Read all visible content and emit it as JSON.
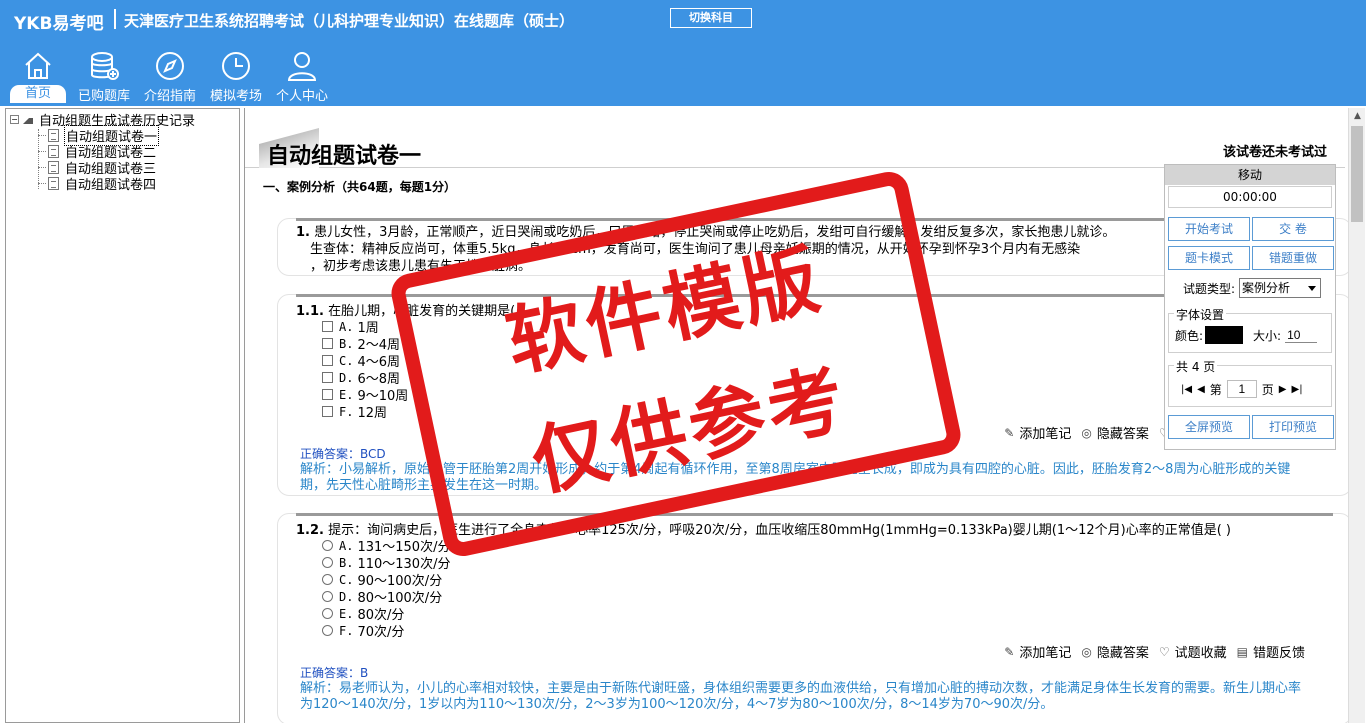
{
  "header": {
    "logo": "YKB易考吧",
    "title": "天津医疗卫生系统招聘考试（儿科护理专业知识）在线题库（硕士）",
    "switch_label": "切换科目",
    "background": "#3d93e3"
  },
  "nav": {
    "home": {
      "label": "首页",
      "icon": "home-icon"
    },
    "purchased": {
      "label": "已购题库",
      "icon": "database-icon"
    },
    "guide": {
      "label": "介绍指南",
      "icon": "compass-icon"
    },
    "mock": {
      "label": "模拟考场",
      "icon": "clock-icon"
    },
    "profile": {
      "label": "个人中心",
      "icon": "user-icon"
    }
  },
  "tree": {
    "root": "自动组题生成试卷历史记录",
    "items": [
      "自动组题试卷一",
      "自动组题试卷二",
      "自动组题试卷三",
      "自动组题试卷四"
    ]
  },
  "paper": {
    "title": "自动组题试卷一",
    "status": "该试卷还未考试过",
    "section": "一、案例分析（共64题，每题1分）"
  },
  "intro": {
    "number": "1.",
    "lines": [
      "患儿女性，3月龄，正常顺产，近日哭闹或吃奶后，口周发绀，停止哭闹或停止吃奶后，发绀可自行缓解，发绀反复多次，家长抱患儿就诊。",
      "生查体：精神反应尚可，体重5.5kg，身长61cm，发育尚可，医生询问了患儿母亲妊娠期的情况，从开始怀孕到怀孕3个月内有无感染",
      "，初步考虑该患儿患有先天性心脏病。"
    ]
  },
  "q1": {
    "number": "1.1.",
    "stem": "在胎儿期，心脏发育的关键期是(    )",
    "options": [
      {
        "key": "A.",
        "text": "1周"
      },
      {
        "key": "B.",
        "text": "2～4周"
      },
      {
        "key": "C.",
        "text": "4～6周"
      },
      {
        "key": "D.",
        "text": "6～8周"
      },
      {
        "key": "E.",
        "text": "9～10周"
      },
      {
        "key": "F.",
        "text": "12周"
      }
    ],
    "answer_label": "正确答案：",
    "answer": "BCD",
    "analysis": "解析：小易解析，原始心管于胚胎第2周开始形成，约于第4周起有循环作用，至第8周房室中隔完全长成，即成为具有四腔的心脏。因此，胚胎发育2～8周为心脏形成的关键期，先天性心脏畸形主要发生在这一时期。"
  },
  "q2": {
    "number": "1.2.",
    "stem": "提示：询问病史后，医生进行了全身查体：心率125次/分，呼吸20次/分，血压收缩压80mmHg(1mmHg=0.133kPa)婴儿期(1～12个月)心率的正常值是(    )",
    "options": [
      {
        "key": "A.",
        "text": "131～150次/分"
      },
      {
        "key": "B.",
        "text": "110～130次/分"
      },
      {
        "key": "C.",
        "text": "90～100次/分"
      },
      {
        "key": "D.",
        "text": "80～100次/分"
      },
      {
        "key": "E.",
        "text": "80次/分"
      },
      {
        "key": "F.",
        "text": "70次/分"
      }
    ],
    "answer_label": "正确答案：",
    "answer": "B",
    "analysis": "解析：易老师认为，小儿的心率相对较快，主要是由于新陈代谢旺盛，身体组织需要更多的血液供给，只有增加心脏的搏动次数，才能满足身体生长发育的需要。新生儿期心率为120～140次/分，1岁以内为110～130次/分，2～3岁为100～120次/分，4～7岁为80～100次/分，8～14岁为70～90次/分。"
  },
  "tools": {
    "note": "添加笔记",
    "hide": "隐藏答案",
    "fav": "试题收藏",
    "feedback": "错题反馈"
  },
  "panel": {
    "move": "移动",
    "timer": "00:00:00",
    "start": "开始考试",
    "submit": "交  卷",
    "card_mode": "题卡模式",
    "redo_wrong": "错题重做",
    "type_label": "试题类型:",
    "type_value": "案例分析",
    "font_legend": "字体设置",
    "color_label": "颜色:",
    "font_color": "#000000",
    "size_label": "大小:",
    "size_value": "10",
    "pages_legend": "共 4 页",
    "page_prefix": "第",
    "page_value": "1",
    "page_suffix": "页",
    "fullscreen": "全屏预览",
    "print": "打印预览"
  },
  "stamp": {
    "line1": "软件模版",
    "line2": "仅供参考",
    "color": "#e21b1b"
  }
}
